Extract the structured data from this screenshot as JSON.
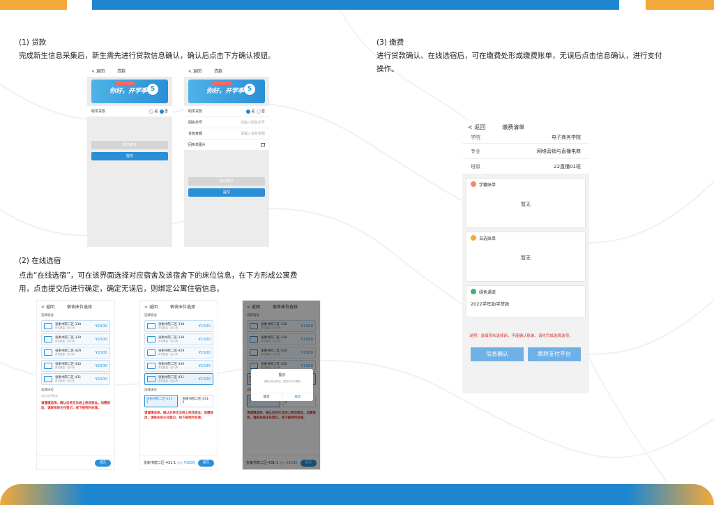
{
  "section1": {
    "heading": "(1) 贷款",
    "desc": "完成新生信息采集后，新生需先进行贷款信息确认，确认后点击下方确认按钮。",
    "screen_a": {
      "back": "返回",
      "title": "贷款",
      "banner_text": "你好，开学季",
      "banner_badge": "5",
      "loan_label": "助学贷款",
      "opt_yes": "是",
      "opt_no": "否",
      "grey_btn": "我已确认",
      "submit_btn": "提交"
    },
    "screen_b": {
      "back": "返回",
      "title": "贷款",
      "banner_text": "你好，开学季",
      "banner_badge": "5",
      "loan_label": "助学贷款",
      "opt_yes": "是",
      "opt_no": "否",
      "field1_label": "回执单号",
      "field1_ph": "请输入回执单号",
      "field2_label": "贷款金额",
      "field2_ph": "请输入贷款金额",
      "field3_label": "回执单图片",
      "grey_btn": "我已确认",
      "submit_btn": "提交"
    }
  },
  "section2": {
    "heading": "(2) 在线选宿",
    "desc_line1": "点击“在线选宿”，可在该界面选择对应宿舍及该宿舍下的床位信息，在下方形成公寓费",
    "desc_line2": "用，点击提交后进行确定，确定无误后，则绑定公寓住宿信息。",
    "nav_back": "返回",
    "nav_title": "宿舍床位选择",
    "sec_dorm": "选择宿舍",
    "sec_bed": "选择床位",
    "bed_placeholder": "请先选择宿舍",
    "rooms": [
      {
        "name": "张衡书院二区-338",
        "sub": "床位数量：四人间",
        "price": "¥1500"
      },
      {
        "name": "张衡书院二区-339",
        "sub": "床位数量：四人间",
        "price": "¥1500"
      },
      {
        "name": "张衡书院二区-429",
        "sub": "床位数量：四人间",
        "price": "¥1500"
      },
      {
        "name": "张衡书院二区-430",
        "sub": "床位数量：四人间",
        "price": "¥1500"
      },
      {
        "name": "张衡书院二区-431",
        "sub": "床位数量：四人间",
        "price": "¥1500"
      }
    ],
    "beds": [
      {
        "name": "张衡书院二区-431-1"
      },
      {
        "name": "张衡书院二区-431-2"
      }
    ],
    "warning": "请谨慎选择，确认后将无法线上修改宿舍。如需修改，请联系班主任登记，线下报到时处理。",
    "submit": "提交",
    "footer_name": "张衡书院二区-431-1",
    "footer_total": "总计",
    "footer_price": "¥1500",
    "dialog_title": "提示",
    "dialog_msg": "请确认所选床位，提交后不可更换",
    "dialog_cancel": "取消",
    "dialog_ok": "确定"
  },
  "section3": {
    "heading": "(3) 缴费",
    "desc_line1": "进行贷款确认、在线选宿后，可在缴费处形成缴费账单，无误后点击信息确认，进行支付",
    "desc_line2": "操作。",
    "screen": {
      "back": "返回",
      "title": "缴费清单",
      "rows": [
        {
          "k": "学院",
          "v": "电子商务学院"
        },
        {
          "k": "专业",
          "v": "网络营销与直播电商"
        },
        {
          "k": "班级",
          "v": "22直播01班"
        }
      ],
      "cards": [
        {
          "title": "学籍账单",
          "body": "暂无",
          "color": "#f08a6e"
        },
        {
          "title": "自选账单",
          "body": "暂无",
          "color": "#f3a93a"
        },
        {
          "title": "绿色通道",
          "body": "2022学年助学贷款",
          "color": "#3cb371"
        }
      ],
      "note": "说明：选填项未选择前，不能确认账单，请先完成选择选项。",
      "btn_confirm": "信息确认",
      "btn_pay": "跳转支付平台"
    }
  },
  "colors": {
    "blue": "#1e86d0",
    "orange": "#f3a93a",
    "warning_red": "#d9342b"
  }
}
